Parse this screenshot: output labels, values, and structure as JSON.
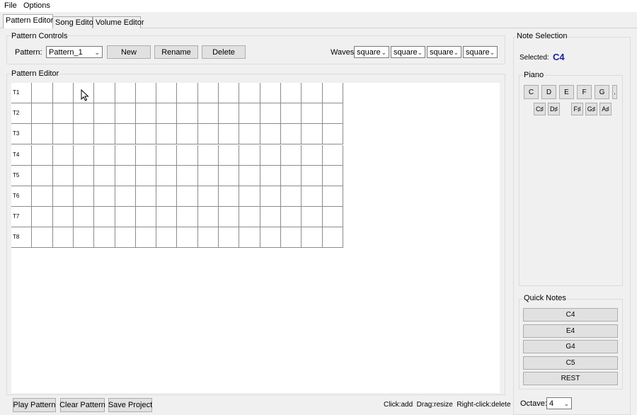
{
  "menu": {
    "file": "File",
    "options": "Options"
  },
  "tabs": [
    {
      "label": "Pattern Editor",
      "active": true
    },
    {
      "label": "Song Editor",
      "active": false
    },
    {
      "label": "Volume Editor",
      "active": false
    }
  ],
  "pattern_controls": {
    "group_title": "Pattern Controls",
    "pattern_label": "Pattern:",
    "pattern_value": "Pattern_1",
    "new_label": "New",
    "rename_label": "Rename",
    "delete_label": "Delete",
    "waves_label": "Waves:",
    "waves": [
      "square",
      "square",
      "square",
      "square"
    ]
  },
  "pattern_editor": {
    "group_title": "Pattern Editor",
    "tracks": [
      "T1",
      "T2",
      "T3",
      "T4",
      "T5",
      "T6",
      "T7",
      "T8"
    ],
    "steps": 16
  },
  "bottom_bar": {
    "play_label": "Play Pattern",
    "clear_label": "Clear Pattern",
    "save_label": "Save Project",
    "help_text": "Click:add  Drag:resize  Right-click:delete"
  },
  "note_selection": {
    "group_title": "Note Selection",
    "selected_label": "Selected:",
    "selected_value": "C4",
    "selected_color": "#1a1aa6",
    "piano_title": "Piano",
    "white_keys": [
      "C",
      "D",
      "E",
      "F",
      "G",
      "."
    ],
    "black_keys": [
      "C♯",
      "D♯",
      "F♯",
      "G♯",
      "A♯"
    ],
    "quick_notes_title": "Quick Notes",
    "quick_notes": [
      "C4",
      "E4",
      "G4",
      "C5",
      "REST"
    ],
    "octave_label": "Octave:",
    "octave_value": "4"
  }
}
